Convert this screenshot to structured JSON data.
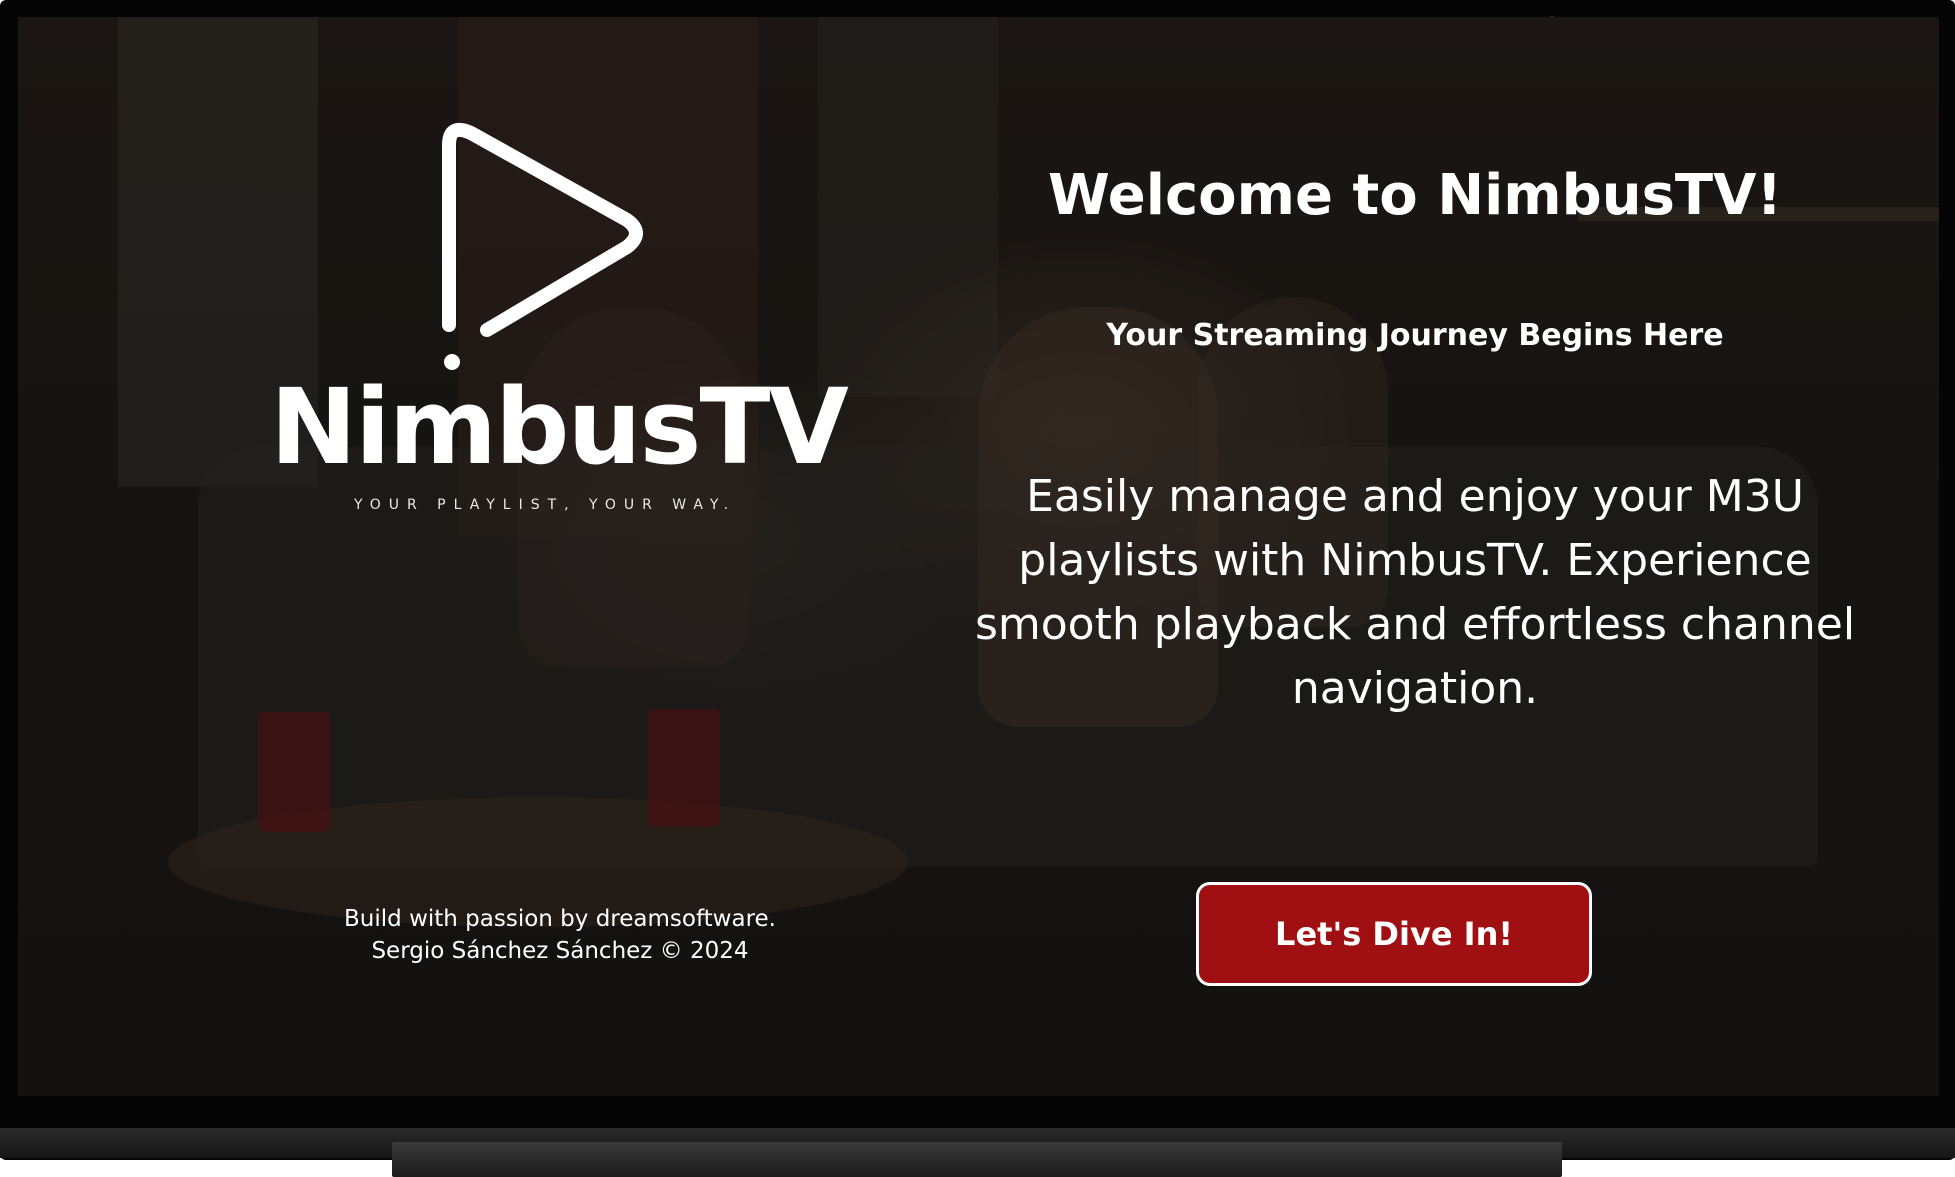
{
  "app": {
    "logo_name": "NimbusTV",
    "logo_tagline": "YOUR PLAYLIST, YOUR WAY.",
    "logo_icon": "play-icon"
  },
  "welcome": {
    "title": "Welcome to NimbusTV!",
    "subtitle": "Your Streaming Journey Begins Here",
    "description": "Easily manage and enjoy your M3U playlists with NimbusTV. Experience smooth playback and effortless channel navigation.",
    "cta_label": "Let's Dive In!"
  },
  "credits": {
    "line1": "Build with passion by dreamsoftware.",
    "line2": "Sergio Sánchez Sánchez © 2024"
  },
  "colors": {
    "accent": "#a00f12",
    "text": "#ffffff",
    "bezel": "#050505"
  }
}
